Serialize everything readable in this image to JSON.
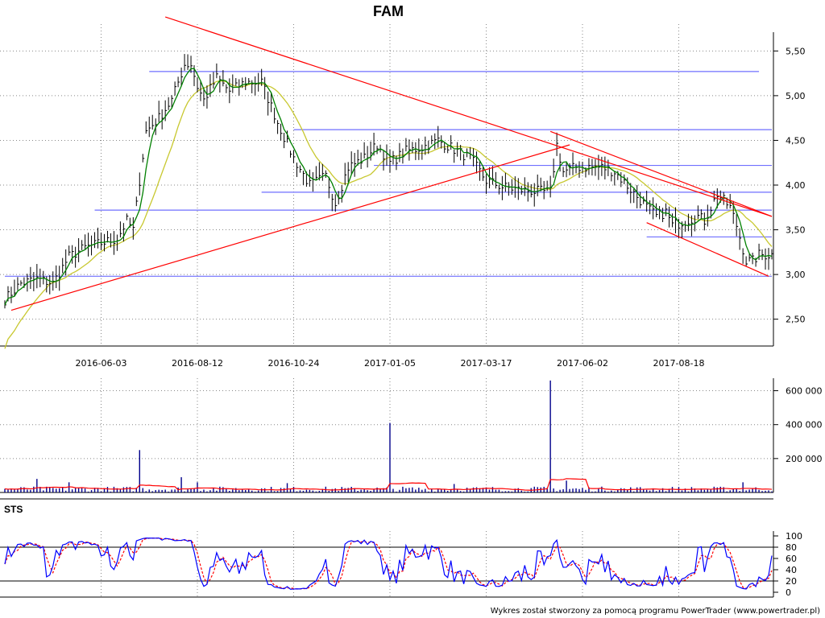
{
  "chart_data": [
    {
      "panel": "price",
      "type": "candlestick",
      "title": "FAM",
      "ylim": [
        2.2,
        5.8
      ],
      "y_ticks": [
        "5,50",
        "5,00",
        "4,50",
        "4,00",
        "3,50",
        "3,00",
        "2,50"
      ],
      "y_tick_values": [
        5.5,
        5.0,
        4.5,
        4.0,
        3.5,
        3.0,
        2.5
      ],
      "x_tick_labels": [
        "2016-06-03",
        "2016-08-12",
        "2016-10-24",
        "2017-01-05",
        "2017-03-17",
        "2017-06-02",
        "2017-08-18"
      ],
      "grid": true,
      "anchors": [
        [
          0,
          2.72
        ],
        [
          5,
          2.9
        ],
        [
          10,
          2.95
        ],
        [
          15,
          2.9
        ],
        [
          20,
          3.2
        ],
        [
          25,
          3.3
        ],
        [
          30,
          3.35
        ],
        [
          35,
          3.4
        ],
        [
          38,
          3.6
        ],
        [
          40,
          3.5
        ],
        [
          44,
          4.6
        ],
        [
          48,
          4.75
        ],
        [
          52,
          4.95
        ],
        [
          56,
          5.35
        ],
        [
          58,
          5.35
        ],
        [
          60,
          5.1
        ],
        [
          62,
          4.95
        ],
        [
          66,
          5.2
        ],
        [
          70,
          5.05
        ],
        [
          75,
          5.15
        ],
        [
          80,
          5.15
        ],
        [
          85,
          4.7
        ],
        [
          90,
          4.3
        ],
        [
          95,
          4.0
        ],
        [
          100,
          4.1
        ],
        [
          103,
          3.8
        ],
        [
          107,
          4.2
        ],
        [
          112,
          4.3
        ],
        [
          116,
          4.45
        ],
        [
          120,
          4.25
        ],
        [
          125,
          4.38
        ],
        [
          130,
          4.42
        ],
        [
          135,
          4.5
        ],
        [
          140,
          4.4
        ],
        [
          145,
          4.3
        ],
        [
          150,
          4.05
        ],
        [
          155,
          3.98
        ],
        [
          160,
          3.95
        ],
        [
          165,
          3.93
        ],
        [
          170,
          3.92
        ],
        [
          172,
          4.45
        ],
        [
          174,
          4.15
        ],
        [
          178,
          4.2
        ],
        [
          182,
          4.2
        ],
        [
          186,
          4.2
        ],
        [
          190,
          4.15
        ],
        [
          195,
          3.95
        ],
        [
          200,
          3.75
        ],
        [
          203,
          3.65
        ],
        [
          206,
          3.7
        ],
        [
          208,
          3.55
        ],
        [
          212,
          3.6
        ],
        [
          216,
          3.65
        ],
        [
          218,
          3.6
        ],
        [
          222,
          3.9
        ],
        [
          226,
          3.75
        ],
        [
          228,
          3.55
        ],
        [
          231,
          3.15
        ],
        [
          233,
          3.15
        ],
        [
          235,
          3.22
        ]
      ],
      "series": [
        {
          "name": "",
          "kind": "moving-average-short",
          "color": "#008000"
        },
        {
          "name": "",
          "kind": "moving-average-long",
          "color": "#c8c830"
        }
      ],
      "horizontal_levels": [
        5.27,
        4.62,
        4.22,
        3.92,
        3.72,
        3.42,
        2.98
      ],
      "trend_lines": [
        {
          "from": [
            50,
            5.88
          ],
          "to": [
            240,
            3.65
          ],
          "color": "#ff0000"
        },
        {
          "from": [
            2,
            2.6
          ],
          "to": [
            176,
            4.45
          ],
          "color": "#ff0000"
        },
        {
          "from": [
            170,
            4.6
          ],
          "to": [
            240,
            3.65
          ],
          "color": "#ff0000"
        },
        {
          "from": [
            200,
            3.58
          ],
          "to": [
            238,
            2.98
          ],
          "color": "#ff0000"
        }
      ]
    },
    {
      "panel": "volume",
      "type": "bar",
      "ylim": [
        0,
        650000
      ],
      "y_ticks": [
        "600 000",
        "400 000",
        "200 000"
      ],
      "y_tick_values": [
        600000,
        400000,
        200000
      ],
      "spikes": [
        [
          10,
          80000
        ],
        [
          20,
          60000
        ],
        [
          42,
          250000
        ],
        [
          55,
          90000
        ],
        [
          60,
          60000
        ],
        [
          88,
          55000
        ],
        [
          120,
          410000
        ],
        [
          140,
          50000
        ],
        [
          170,
          660000
        ],
        [
          175,
          70000
        ],
        [
          230,
          60000
        ]
      ],
      "series": [
        {
          "name": "",
          "kind": "volume",
          "color": "#00008b"
        },
        {
          "name": "",
          "kind": "volume-average",
          "color": "#ff0000"
        }
      ]
    },
    {
      "panel": "oscillator",
      "type": "line",
      "label": "STS",
      "ylim": [
        0,
        100
      ],
      "y_ticks": [
        "100",
        "80",
        "60",
        "40",
        "20",
        "0"
      ],
      "y_tick_values": [
        100,
        80,
        60,
        40,
        20,
        0
      ],
      "levels": [
        80,
        20
      ],
      "series": [
        {
          "name": "",
          "kind": "stochastic-k",
          "color": "#0000ff"
        },
        {
          "name": "",
          "kind": "stochastic-d",
          "color": "#ff0000",
          "dashed": true
        }
      ]
    }
  ],
  "footer": "Wykres został stworzony za pomocą programu PowerTrader (www.powertrader.pl)"
}
